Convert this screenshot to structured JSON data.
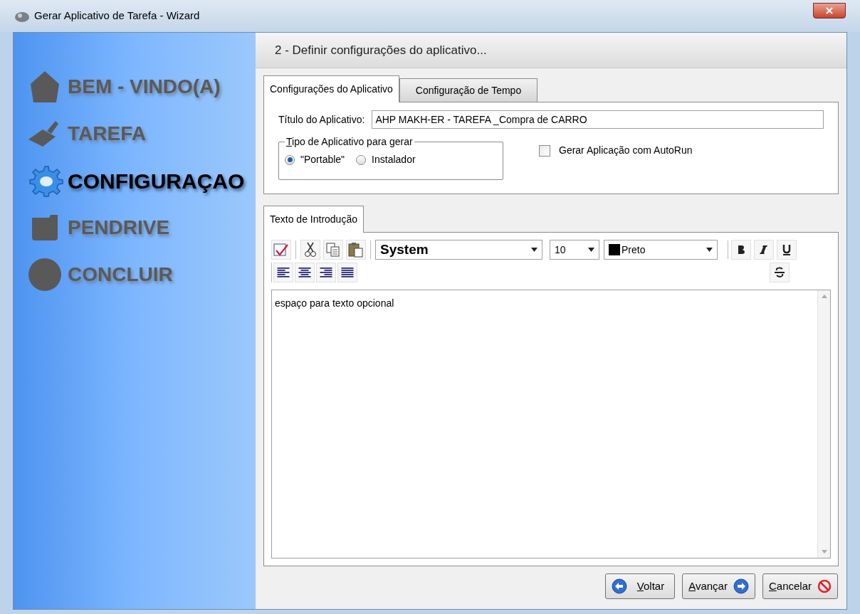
{
  "window": {
    "title": "Gerar Aplicativo de Tarefa - Wizard"
  },
  "steps": [
    {
      "label": "BEM - VINDO(A)",
      "kind": "house",
      "selected": false
    },
    {
      "label": "TAREFA",
      "kind": "brush",
      "selected": false
    },
    {
      "label": "CONFIGURAÇAO",
      "kind": "gear",
      "selected": true
    },
    {
      "label": "PENDRIVE",
      "kind": "drive",
      "selected": false
    },
    {
      "label": "CONCLUIR",
      "kind": "circle",
      "selected": false
    }
  ],
  "header": "2 - Definir configurações do aplicativo...",
  "tabs": [
    {
      "label": "Configurações do Aplicativo",
      "selected": true
    },
    {
      "label": "Configuração de Tempo",
      "selected": false
    }
  ],
  "title_field": {
    "label": "Título do Aplicativo:",
    "value": "AHP MAKH-ER - TAREFA _Compra de CARRO"
  },
  "app_type": {
    "legend": "Tipo de Aplicativo para gerar",
    "options": [
      {
        "label": "\"Portable\"",
        "selected": true
      },
      {
        "label": "Instalador",
        "selected": false
      }
    ]
  },
  "autorun": {
    "label": "Gerar Aplicação com AutoRun",
    "checked": false
  },
  "intro_tabs": [
    {
      "label": "Texto de Introdução",
      "selected": true
    }
  ],
  "editor": {
    "font": "System",
    "size": "10",
    "color_name": "Preto",
    "color": "#000000",
    "text": "espaço para texto opcional"
  },
  "buttons": [
    {
      "label": "Voltar",
      "kind": "back"
    },
    {
      "label": "Avançar",
      "kind": "next"
    },
    {
      "label": "Cancelar",
      "kind": "cancel"
    }
  ]
}
